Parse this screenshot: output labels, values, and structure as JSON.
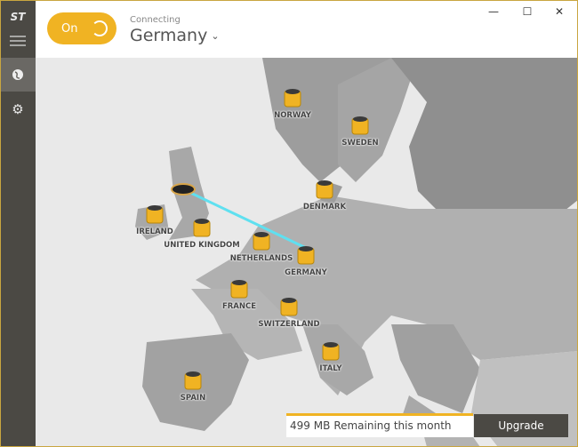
{
  "header": {
    "toggle_label": "On",
    "status": "Connecting",
    "country": "Germany"
  },
  "window": {
    "minimize": "—",
    "maximize": "☐",
    "close": "✕"
  },
  "map": {
    "countries": [
      {
        "name": "NORWAY"
      },
      {
        "name": "SWEDEN"
      },
      {
        "name": "DENMARK"
      },
      {
        "name": "IRELAND"
      },
      {
        "name": "UNITED KINGDOM"
      },
      {
        "name": "NETHERLANDS"
      },
      {
        "name": "GERMANY"
      },
      {
        "name": "FRANCE"
      },
      {
        "name": "SWITZERLAND"
      },
      {
        "name": "ITALY"
      },
      {
        "name": "SPAIN"
      }
    ]
  },
  "data_bar": {
    "amount": "499 MB",
    "remaining_text": "Remaining this month",
    "progress": 1.0,
    "upgrade_label": "Upgrade"
  },
  "colors": {
    "accent": "#f0b323",
    "sidebar": "#4b4944",
    "tunnel": "#5fe0f0"
  }
}
